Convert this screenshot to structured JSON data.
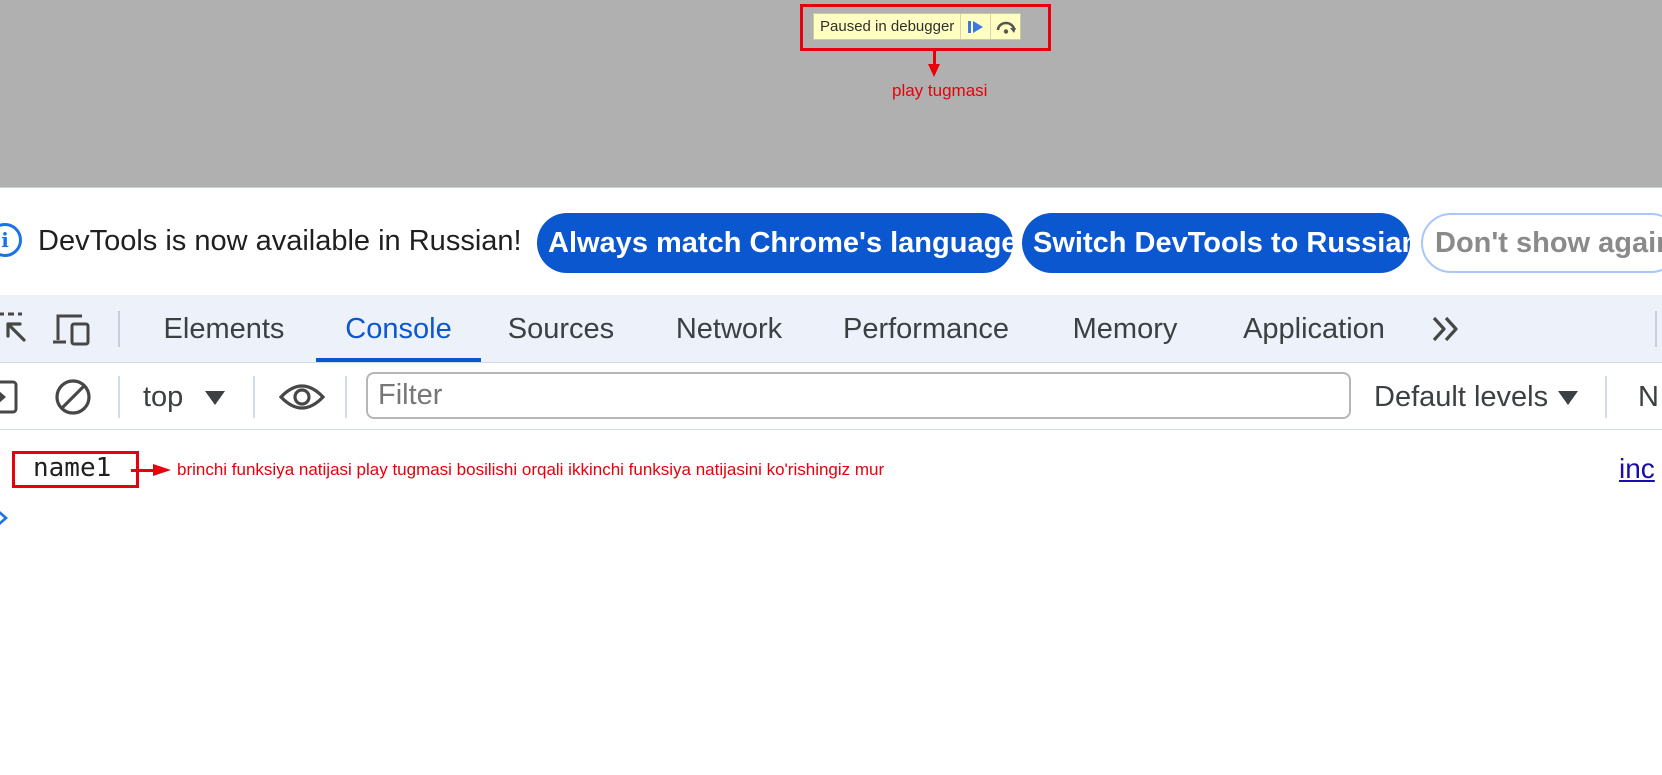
{
  "overlay": {
    "paused_text": "Paused in debugger",
    "resume_icon": "resume-play-icon",
    "step_over_icon": "step-over-icon",
    "annotation": "play tugmasi",
    "annotation_color": "#e8000b"
  },
  "infobar": {
    "icon": "info-icon",
    "message": "DevTools is now available in Russian!",
    "buttons": {
      "always_match": "Always match Chrome's language",
      "switch": "Switch DevTools to Russian",
      "dont_show": "Don't show again"
    }
  },
  "tabbar": {
    "inspect_icon": "inspect-element-icon",
    "device_icon": "device-toolbar-icon",
    "tabs": [
      "Elements",
      "Console",
      "Sources",
      "Network",
      "Performance",
      "Memory",
      "Application"
    ],
    "active_tab": "Console",
    "more_icon": "more-tabs-icon"
  },
  "console_toolbar": {
    "sidebar_icon": "show-console-sidebar-icon",
    "clear_icon": "clear-console-icon",
    "context": "top",
    "eye_icon": "live-expression-eye-icon",
    "filter_placeholder": "Filter",
    "levels": "Default levels",
    "issues_partial": "N"
  },
  "console_output": {
    "log_value": "name1",
    "annotation": "brinchi funksiya natijasi play tugmasi bosilishi orqali ikkinchi funksiya natijasini ko'rishingiz mur",
    "source_link": "inc",
    "prompt_icon": "console-prompt-chevron-icon"
  },
  "colors": {
    "accent": "#0b57d0",
    "overlay_bg": "#b0b0b0",
    "tabbar_bg": "#edf2fa",
    "annotation_red": "#e8000b"
  }
}
